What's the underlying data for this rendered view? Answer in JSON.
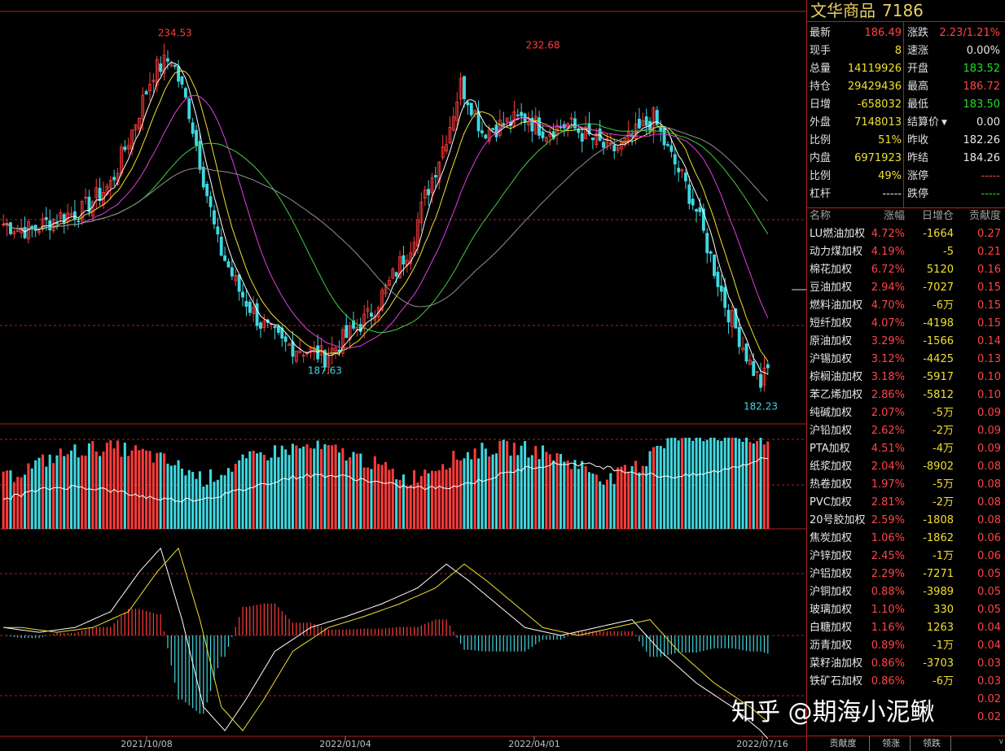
{
  "colors": {
    "up": "#ff3b3b",
    "down": "#3fd8e0",
    "ma5": "#ffffff",
    "ma10": "#f0e030",
    "ma20": "#e040e0",
    "ma40": "#40d040",
    "ma60": "#909090",
    "grid": "#b02020"
  },
  "instrument": {
    "name": "文华商品",
    "code": "7186"
  },
  "quote": [
    {
      "l1": "最新",
      "v1": "186.49",
      "c1": "red",
      "l2": "涨跌",
      "v2": "2.23/1.21%",
      "c2": "red"
    },
    {
      "l1": "现手",
      "v1": "8",
      "c1": "yellow",
      "l2": "速涨",
      "v2": "0.00%",
      "c2": "white"
    },
    {
      "l1": "总量",
      "v1": "14119926",
      "c1": "yellow",
      "l2": "开盘",
      "v2": "183.52",
      "c2": "green"
    },
    {
      "l1": "持仓",
      "v1": "29429436",
      "c1": "yellow",
      "l2": "最高",
      "v2": "186.72",
      "c2": "red"
    },
    {
      "l1": "日增",
      "v1": "-658032",
      "c1": "yellow",
      "l2": "最低",
      "v2": "183.50",
      "c2": "green"
    },
    {
      "l1": "外盘",
      "v1": "7148013",
      "c1": "yellow",
      "l2": "结算价",
      "v2": "0.00",
      "c2": "white"
    },
    {
      "l1": "比例",
      "v1": "51%",
      "c1": "yellow",
      "l2": "昨收",
      "v2": "182.26",
      "c2": "white"
    },
    {
      "l1": "内盘",
      "v1": "6971923",
      "c1": "yellow",
      "l2": "昨结",
      "v2": "184.26",
      "c2": "white"
    },
    {
      "l1": "比例",
      "v1": "49%",
      "c1": "yellow",
      "l2": "涨停",
      "v2": "-----",
      "c2": "red"
    },
    {
      "l1": "杠杆",
      "v1": "-----",
      "c1": "white",
      "l2": "跌停",
      "v2": "-----",
      "c2": "green"
    }
  ],
  "table": {
    "headers": [
      "名称",
      "涨幅",
      "日增仓",
      "贡献度"
    ],
    "rows": [
      [
        "LU燃油加权",
        "4.72%",
        "-1664",
        "0.27"
      ],
      [
        "动力煤加权",
        "4.19%",
        "-5",
        "0.21"
      ],
      [
        "棉花加权",
        "6.72%",
        "5120",
        "0.16"
      ],
      [
        "豆油加权",
        "2.94%",
        "-7027",
        "0.15"
      ],
      [
        "燃料油加权",
        "4.70%",
        "-6万",
        "0.15"
      ],
      [
        "短纤加权",
        "4.07%",
        "-4198",
        "0.15"
      ],
      [
        "原油加权",
        "3.29%",
        "-1566",
        "0.14"
      ],
      [
        "沪锡加权",
        "3.12%",
        "-4425",
        "0.13"
      ],
      [
        "棕榈油加权",
        "3.18%",
        "-5917",
        "0.10"
      ],
      [
        "苯乙烯加权",
        "2.86%",
        "-5812",
        "0.10"
      ],
      [
        "纯碱加权",
        "2.07%",
        "-5万",
        "0.09"
      ],
      [
        "沪铅加权",
        "2.62%",
        "-2万",
        "0.09"
      ],
      [
        "PTA加权",
        "4.51%",
        "-4万",
        "0.09"
      ],
      [
        "纸浆加权",
        "2.04%",
        "-8902",
        "0.08"
      ],
      [
        "热卷加权",
        "1.97%",
        "-5万",
        "0.08"
      ],
      [
        "PVC加权",
        "2.81%",
        "-2万",
        "0.08"
      ],
      [
        "20号胶加权",
        "2.59%",
        "-1808",
        "0.08"
      ],
      [
        "焦炭加权",
        "1.06%",
        "-1862",
        "0.06"
      ],
      [
        "沪锌加权",
        "2.45%",
        "-1万",
        "0.06"
      ],
      [
        "沪铝加权",
        "2.29%",
        "-7271",
        "0.05"
      ],
      [
        "沪铜加权",
        "0.88%",
        "-3989",
        "0.05"
      ],
      [
        "玻璃加权",
        "1.10%",
        "330",
        "0.05"
      ],
      [
        "白糖加权",
        "1.16%",
        "1263",
        "0.04"
      ],
      [
        "沥青加权",
        "0.89%",
        "-1万",
        "0.04"
      ],
      [
        "菜籽油加权",
        "0.86%",
        "-3703",
        "0.03"
      ],
      [
        "铁矿石加权",
        "0.86%",
        "-6万",
        "0.03"
      ],
      [
        "",
        "",
        "",
        "0.02"
      ],
      [
        "",
        "",
        "",
        "0.02"
      ]
    ]
  },
  "tabs": [
    "贡献度",
    "领涨",
    "领跌"
  ],
  "watermark": "知乎 @期海小泥鳅",
  "chart_data": {
    "type": "candlestick",
    "x_ticks": [
      "2021/10/08",
      "2022/01/04",
      "2022/04/01",
      "2022/07/16"
    ],
    "annotations": [
      {
        "label": "234.53",
        "kind": "high",
        "value": 234.53
      },
      {
        "label": "187.63",
        "kind": "low",
        "value": 187.63
      },
      {
        "label": "232.68",
        "kind": "high",
        "value": 232.68
      },
      {
        "label": "182.23",
        "kind": "low",
        "value": 182.23
      }
    ],
    "price_range": [
      178,
      240
    ],
    "price_path": [
      [
        0,
        208
      ],
      [
        8,
        207
      ],
      [
        15,
        209
      ],
      [
        22,
        210
      ],
      [
        30,
        214
      ],
      [
        36,
        222
      ],
      [
        42,
        231
      ],
      [
        47,
        233
      ],
      [
        52,
        225
      ],
      [
        56,
        215
      ],
      [
        60,
        205
      ],
      [
        66,
        198
      ],
      [
        72,
        193
      ],
      [
        78,
        190
      ],
      [
        85,
        189
      ],
      [
        90,
        188
      ],
      [
        96,
        191
      ],
      [
        102,
        194
      ],
      [
        108,
        199
      ],
      [
        114,
        205
      ],
      [
        118,
        212
      ],
      [
        122,
        218
      ],
      [
        125,
        223
      ],
      [
        128,
        229
      ],
      [
        131,
        226
      ],
      [
        134,
        222
      ],
      [
        140,
        223
      ],
      [
        146,
        224
      ],
      [
        152,
        222
      ],
      [
        158,
        223
      ],
      [
        164,
        221
      ],
      [
        170,
        219
      ],
      [
        174,
        220
      ],
      [
        178,
        222
      ],
      [
        182,
        224
      ],
      [
        186,
        219
      ],
      [
        190,
        215
      ],
      [
        194,
        210
      ],
      [
        198,
        203
      ],
      [
        202,
        196
      ],
      [
        206,
        191
      ],
      [
        209,
        187
      ],
      [
        212,
        184
      ],
      [
        214,
        186
      ]
    ],
    "volume_range": [
      0,
      100
    ],
    "macd_range": [
      -1,
      1
    ],
    "macd_path": [
      [
        0,
        0.05
      ],
      [
        10,
        0.02
      ],
      [
        20,
        0.05
      ],
      [
        30,
        0.15
      ],
      [
        38,
        0.4
      ],
      [
        44,
        0.55
      ],
      [
        50,
        0.1
      ],
      [
        56,
        -0.45
      ],
      [
        62,
        -0.6
      ],
      [
        68,
        -0.4
      ],
      [
        76,
        -0.1
      ],
      [
        86,
        0.05
      ],
      [
        96,
        0.12
      ],
      [
        106,
        0.2
      ],
      [
        116,
        0.3
      ],
      [
        124,
        0.45
      ],
      [
        130,
        0.35
      ],
      [
        138,
        0.2
      ],
      [
        146,
        0.05
      ],
      [
        156,
        0.0
      ],
      [
        166,
        0.05
      ],
      [
        176,
        0.1
      ],
      [
        184,
        -0.1
      ],
      [
        194,
        -0.3
      ],
      [
        204,
        -0.45
      ],
      [
        212,
        -0.6
      ],
      [
        214,
        -0.65
      ]
    ]
  }
}
